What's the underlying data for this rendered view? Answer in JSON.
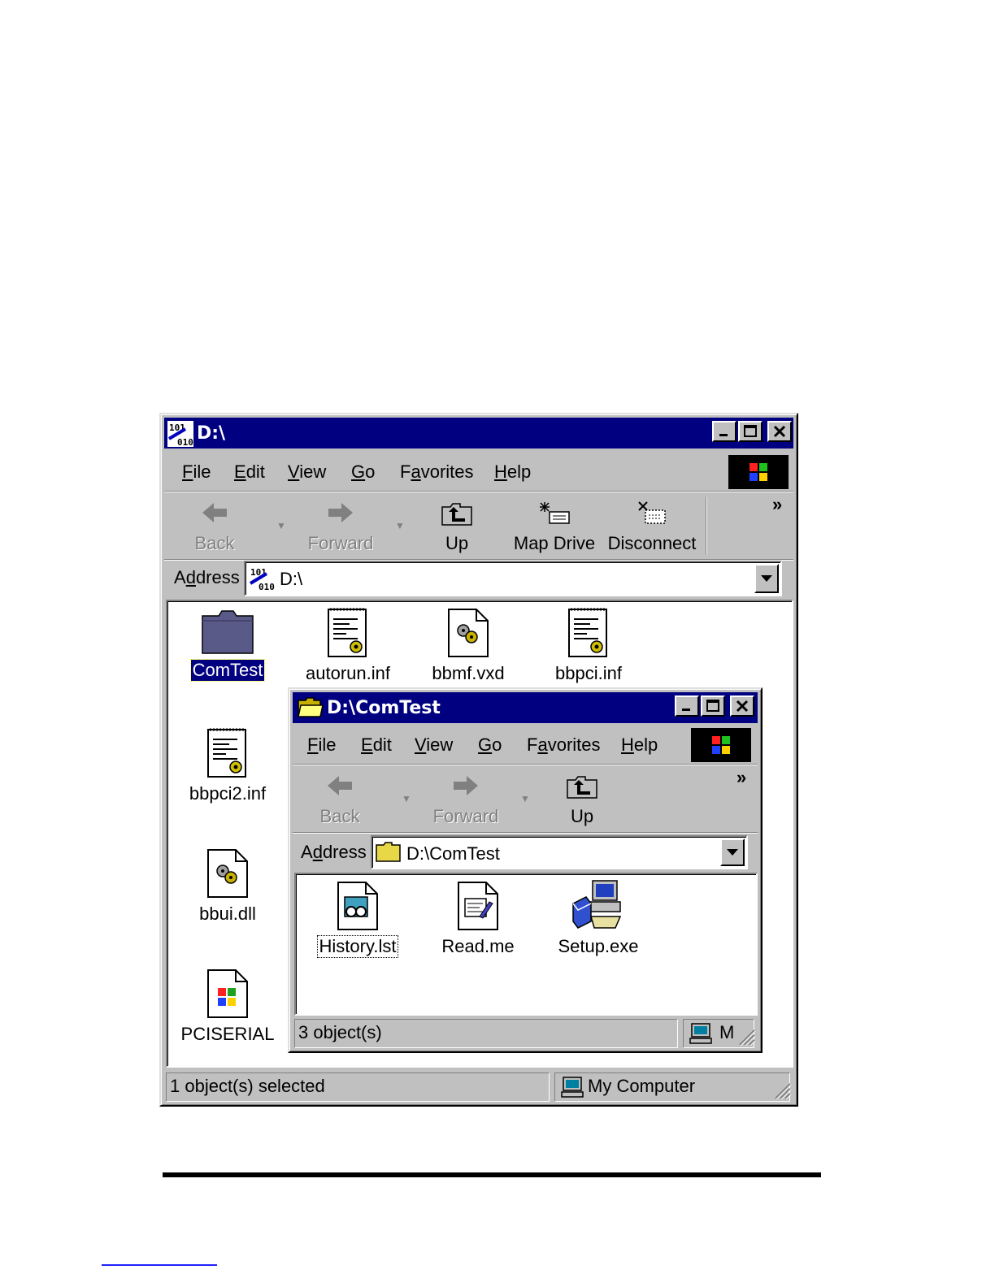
{
  "outer_window": {
    "title": "D:\\",
    "menu": [
      "File",
      "Edit",
      "View",
      "Go",
      "Favorites",
      "Help"
    ],
    "toolbar": {
      "back": "Back",
      "forward": "Forward",
      "up": "Up",
      "map_drive": "Map Drive",
      "disconnect": "Disconnect",
      "more": "»"
    },
    "address_label": "Address",
    "address_value": "D:\\",
    "files": [
      {
        "name": "ComTest",
        "icon": "folder-icon",
        "selected": true
      },
      {
        "name": "autorun.inf",
        "icon": "inf-file-icon"
      },
      {
        "name": "bbmf.vxd",
        "icon": "system-file-icon"
      },
      {
        "name": "bbpci.inf",
        "icon": "inf-file-icon"
      },
      {
        "name": "bbpci2.inf",
        "icon": "inf-file-icon"
      },
      {
        "name": "bbui.dll",
        "icon": "system-file-icon"
      },
      {
        "name": "PCISERIAL",
        "icon": "windows-file-icon"
      }
    ],
    "status_left": "1 object(s) selected",
    "status_right": "My Computer"
  },
  "inner_window": {
    "title": "D:\\ComTest",
    "menu": [
      "File",
      "Edit",
      "View",
      "Go",
      "Favorites",
      "Help"
    ],
    "toolbar": {
      "back": "Back",
      "forward": "Forward",
      "up": "Up",
      "more": "»"
    },
    "address_label": "Address",
    "address_value": "D:\\ComTest",
    "files": [
      {
        "name": "History.lst",
        "icon": "viewer-file-icon",
        "focused": true
      },
      {
        "name": "Read.me",
        "icon": "text-document-icon"
      },
      {
        "name": "Setup.exe",
        "icon": "setup-installer-icon"
      }
    ],
    "status_left": "3 object(s)",
    "status_right": "M"
  }
}
